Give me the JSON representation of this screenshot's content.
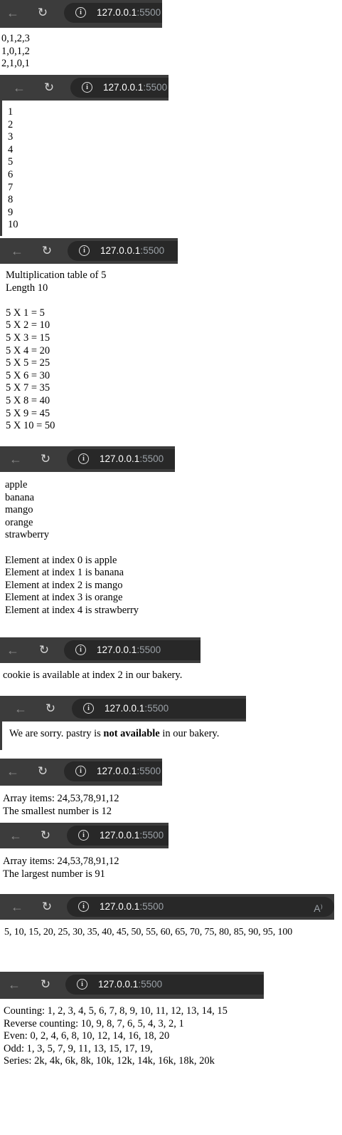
{
  "browser": {
    "host": "127.0.0.1",
    "port": ":5500",
    "reader_label": "A⁾"
  },
  "panels": {
    "p1": {
      "lines": [
        "0,1,2,3",
        "1,0,1,2",
        "2,1,0,1"
      ]
    },
    "p2": {
      "lines": [
        "1",
        "2",
        "3",
        "4",
        "5",
        "6",
        "7",
        "8",
        "9",
        "10"
      ]
    },
    "p3": {
      "title": "Multiplication table of 5",
      "length": "Length 10",
      "rows": [
        "5 X 1 = 5",
        "5 X 2 = 10",
        "5 X 3 = 15",
        "5 X 4 = 20",
        "5 X 5 = 25",
        "5 X 6 = 30",
        "5 X 7 = 35",
        "5 X 8 = 40",
        "5 X 9 = 45",
        "5 X 10 = 50"
      ]
    },
    "p4": {
      "fruits": [
        "apple",
        "banana",
        "mango",
        "orange",
        "strawberry"
      ],
      "index_lines": [
        "Element at index 0 is apple",
        "Element at index 1 is banana",
        "Element at index 2 is mango",
        "Element at index 3 is orange",
        "Element at index 4 is strawberry"
      ]
    },
    "p5": {
      "text": "cookie is available at index 2 in our bakery."
    },
    "p6": {
      "prefix": "We are sorry. pastry is ",
      "bold": "not available",
      "suffix": " in our bakery."
    },
    "p7": {
      "items": "Array items: 24,53,78,91,12",
      "result": "The smallest number is 12"
    },
    "p8": {
      "items": "Array items: 24,53,78,91,12",
      "result": "The largest number is 91"
    },
    "p9": {
      "text": "5, 10, 15, 20, 25, 30, 35, 40, 45, 50, 55, 60, 65, 70, 75, 80, 85, 90, 95, 100"
    },
    "p10": {
      "lines": [
        "Counting: 1, 2, 3, 4, 5, 6, 7, 8, 9, 10, 11, 12, 13, 14, 15",
        "Reverse counting: 10, 9, 8, 7, 6, 5, 4, 3, 2, 1",
        "Even: 0, 2, 4, 6, 8, 10, 12, 14, 16, 18, 20",
        "Odd: 1, 3, 5, 7, 9, 11, 13, 15, 17, 19,",
        "Series: 2k, 4k, 6k, 8k, 10k, 12k, 14k, 16k, 18k, 20k"
      ]
    }
  }
}
